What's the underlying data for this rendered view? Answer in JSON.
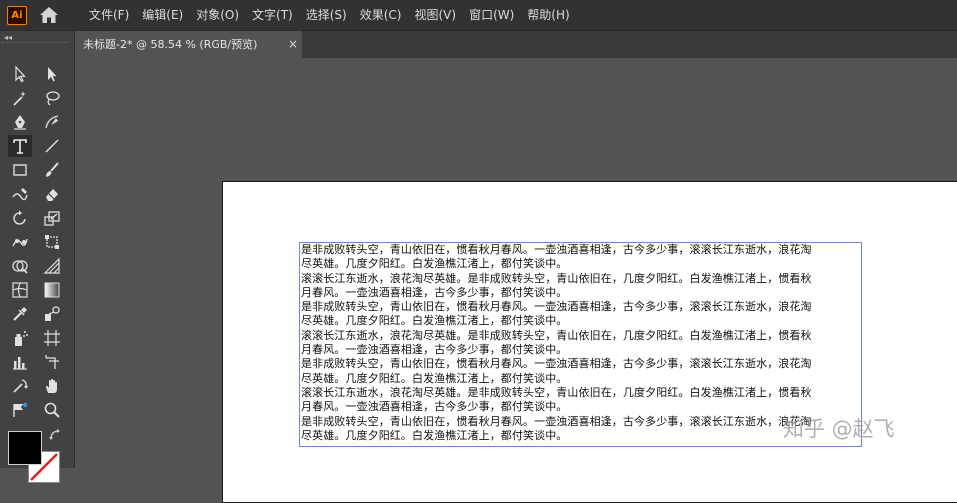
{
  "app": {
    "logo_text": "Ai"
  },
  "menu": [
    "文件(F)",
    "编辑(E)",
    "对象(O)",
    "文字(T)",
    "选择(S)",
    "效果(C)",
    "视图(V)",
    "窗口(W)",
    "帮助(H)"
  ],
  "document_tab": {
    "title": "未标题-2* @ 58.54 % (RGB/预览)",
    "close_glyph": "×"
  },
  "tools_panel": {
    "collapse_glyph": "◂◂"
  },
  "text_frame": {
    "lines": [
      "是非成败转头空，青山依旧在，惯看秋月春风。一壶浊酒喜相逢，古今多少事，滚滚长江东逝水，浪花淘",
      "尽英雄。几度夕阳红。白发渔樵江渚上，都付笑谈中。",
      "滚滚长江东逝水，浪花淘尽英雄。是非成败转头空，青山依旧在，几度夕阳红。白发渔樵江渚上，惯看秋",
      "月春风。一壶浊酒喜相逢，古今多少事，都付笑谈中。",
      "是非成败转头空，青山依旧在，惯看秋月春风。一壶浊酒喜相逢，古今多少事，滚滚长江东逝水，浪花淘",
      "尽英雄。几度夕阳红。白发渔樵江渚上，都付笑谈中。",
      "滚滚长江东逝水，浪花淘尽英雄。是非成败转头空，青山依旧在，几度夕阳红。白发渔樵江渚上，惯看秋",
      "月春风。一壶浊酒喜相逢，古今多少事，都付笑谈中。",
      "是非成败转头空，青山依旧在，惯看秋月春风。一壶浊酒喜相逢，古今多少事，滚滚长江东逝水，浪花淘",
      "尽英雄。几度夕阳红。白发渔樵江渚上，都付笑谈中。",
      "滚滚长江东逝水，浪花淘尽英雄。是非成败转头空，青山依旧在，几度夕阳红。白发渔樵江渚上，惯看秋",
      "月春风。一壶浊酒喜相逢，古今多少事，都付笑谈中。",
      "是非成败转头空，青山依旧在，惯看秋月春风。一壶浊酒喜相逢，古今多少事，滚滚长江东逝水，浪花淘",
      "尽英雄。几度夕阳红。白发渔樵江渚上，都付笑谈中。"
    ]
  },
  "watermark": {
    "text": "知乎 @赵飞"
  },
  "colors": {
    "menubar_bg": "#323232",
    "panel_bg": "#424242",
    "workspace_bg": "#535353",
    "artboard_bg": "#ffffff",
    "selection_blue": "#6f87d6",
    "logo_orange": "#ff7c00",
    "fill_color": "#000000",
    "stroke_color": "none"
  },
  "tools": [
    "selection-tool-icon",
    "direct-selection-tool-icon",
    "magic-wand-tool-icon",
    "lasso-tool-icon",
    "pen-tool-icon",
    "curvature-tool-icon",
    "type-tool-icon",
    "line-segment-tool-icon",
    "rectangle-tool-icon",
    "paintbrush-tool-icon",
    "shaper-tool-icon",
    "eraser-tool-icon",
    "rotate-tool-icon",
    "scale-tool-icon",
    "puppet-warp-tool-icon",
    "free-transform-tool-icon",
    "shape-builder-tool-icon",
    "perspective-grid-tool-icon",
    "mesh-tool-icon",
    "gradient-tool-icon",
    "eyedropper-tool-icon",
    "blend-tool-icon",
    "symbol-sprayer-tool-icon",
    "artboard-tool-icon",
    "column-graph-tool-icon",
    "slice-tool-icon",
    "hand-tool-icon",
    "zoom-tool-icon",
    "rotate-view-tool-icon",
    "edit-toolbar-icon"
  ]
}
